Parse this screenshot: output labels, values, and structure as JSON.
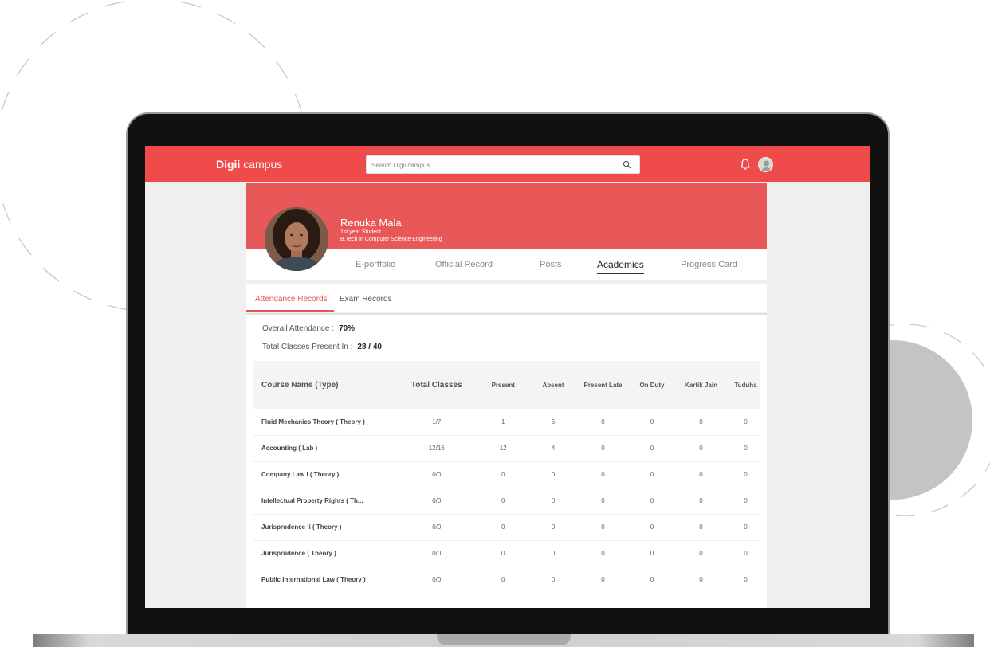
{
  "app": {
    "logo_bold": "Digii",
    "logo_rest": " campus",
    "search_placeholder": "Search Digii campus"
  },
  "icons": {
    "search": "search-icon",
    "notifications": "bell-icon",
    "user": "user-avatar"
  },
  "colors": {
    "brand": "#f04b4b",
    "banner": "#e95858",
    "accent_text": "#e85555"
  },
  "profile": {
    "name": "Renuka Mala",
    "year": "1st year Student",
    "program": "B.Tech in Computer Science Engineering",
    "tabs": [
      "E-portfolio",
      "Official Record",
      "Posts",
      "Academics",
      "Progress Card"
    ],
    "active_tab": "Academics"
  },
  "subtabs": {
    "items": [
      "Attendance Records",
      "Exam Records"
    ],
    "active": "Attendance Records"
  },
  "attendance": {
    "overall_label": "Overall Attendance :",
    "overall_value": "70%",
    "present_label": "Total Classes Present In :",
    "present_value": "28 / 40"
  },
  "table": {
    "headers": [
      "Course Name (Type)",
      "Total Classes",
      "Present",
      "Absent",
      "Present Late",
      "On Duty",
      "Kartik Jain",
      "Tuduha"
    ],
    "rows": [
      [
        "Fluid Mechanics Theory ( Theory )",
        "1/7",
        "1",
        "6",
        "0",
        "0",
        "0",
        "0"
      ],
      [
        "Accounting ( Lab )",
        "12/16",
        "12",
        "4",
        "0",
        "0",
        "0",
        "0"
      ],
      [
        "Company Law I ( Theory )",
        "0/0",
        "0",
        "0",
        "0",
        "0",
        "0",
        "0"
      ],
      [
        "Intellectual Property Rights ( Th...",
        "0/0",
        "0",
        "0",
        "0",
        "0",
        "0",
        "0"
      ],
      [
        "Jurisprudence Ii ( Theory )",
        "0/0",
        "0",
        "0",
        "0",
        "0",
        "0",
        "0"
      ],
      [
        "Jurisprudence ( Theory )",
        "0/0",
        "0",
        "0",
        "0",
        "0",
        "0",
        "0"
      ],
      [
        "Public International Law ( Theory )",
        "0/0",
        "0",
        "0",
        "0",
        "0",
        "0",
        "0"
      ]
    ]
  }
}
